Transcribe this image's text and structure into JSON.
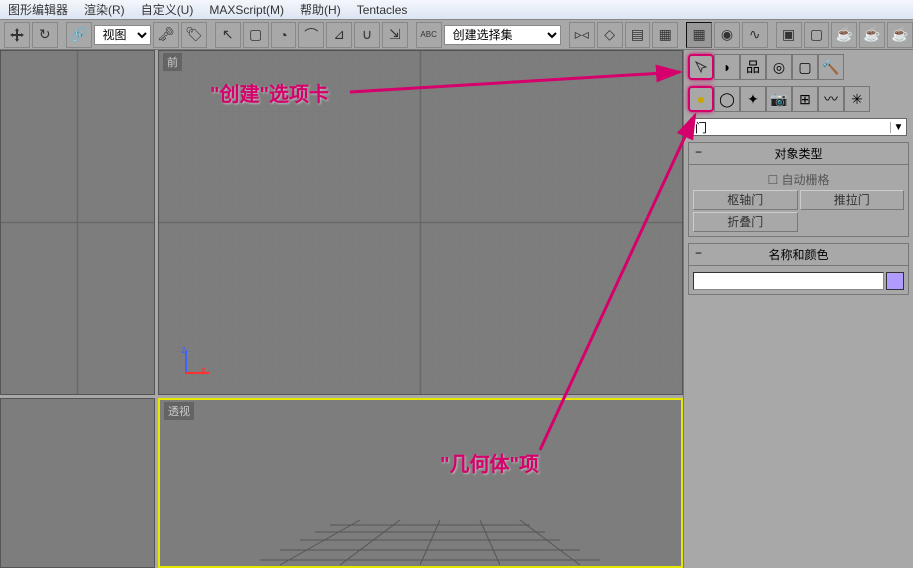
{
  "menu": {
    "items": [
      "图形编辑器",
      "渲染(R)",
      "自定义(U)",
      "MAXScript(M)",
      "帮助(H)",
      "Tentacles"
    ]
  },
  "toolbar": {
    "view_combo": "视图",
    "selection_set": "创建选择集"
  },
  "viewports": {
    "front_label": "前",
    "persp_label": "透视"
  },
  "cmdpanel": {
    "dropdown": "门",
    "rollout_type": "对象类型",
    "auto_grid": "自动栅格",
    "btns": [
      "枢轴门",
      "推拉门",
      "折叠门"
    ],
    "rollout_name": "名称和颜色"
  },
  "annotations": {
    "create_tab": "\"创建\"选项卡",
    "geometry_item": "\"几何体\"项"
  },
  "colors": {
    "accent": "#d6006c",
    "swatch": "#b09cff"
  }
}
